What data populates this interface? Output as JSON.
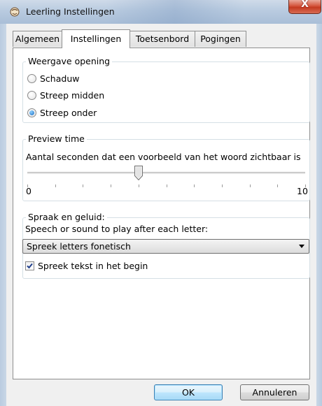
{
  "window": {
    "title": "Leerling Instellingen",
    "close_glyph": "X"
  },
  "tabs": [
    {
      "label": "Algemeen",
      "active": false
    },
    {
      "label": "Instellingen",
      "active": true
    },
    {
      "label": "Toetsenbord",
      "active": false
    },
    {
      "label": "Pogingen",
      "active": false
    }
  ],
  "display_group": {
    "legend": "Weergave opening",
    "options": [
      {
        "label": "Schaduw",
        "selected": false
      },
      {
        "label": "Streep midden",
        "selected": false
      },
      {
        "label": "Streep onder",
        "selected": true
      }
    ]
  },
  "preview_group": {
    "legend": "Preview time",
    "description": "Aantal seconden dat een voorbeeld van het woord zichtbaar is",
    "slider": {
      "min_label": "0",
      "max_label": "10",
      "min": 0,
      "max": 10,
      "value": 4
    }
  },
  "speech_group": {
    "legend": "Spraak en geluid:",
    "prompt": "Speech or sound to play after each letter:",
    "selected_option": "Spreek letters fonetisch",
    "checkbox_label": "Spreek tekst in het begin",
    "checkbox_checked": true
  },
  "buttons": {
    "ok": "OK",
    "cancel": "Annuleren"
  },
  "colors": {
    "radio_dot": "#1d6fc4",
    "close_button": "#c43a20",
    "default_button_border": "#3c7fb1"
  },
  "icons": {
    "app": "app-icon",
    "dropdown": "chevron-down-icon",
    "check": "checkmark-icon"
  }
}
